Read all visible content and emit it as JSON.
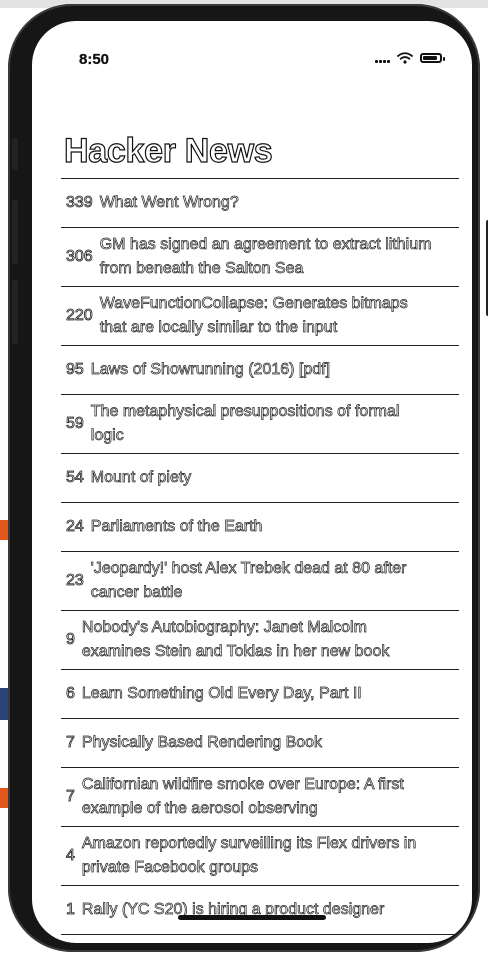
{
  "status_bar": {
    "time": "8:50"
  },
  "app": {
    "title": "Hacker News"
  },
  "stories": [
    {
      "score": "339",
      "title": "What Went Wrong?"
    },
    {
      "score": "306",
      "title": "GM has signed an agreement to extract lithium from beneath the Salton Sea"
    },
    {
      "score": "220",
      "title": "WaveFunctionCollapse: Generates bitmaps that are locally similar to the input"
    },
    {
      "score": "95",
      "title": "Laws of Showrunning (2016) [pdf]"
    },
    {
      "score": "59",
      "title": "The metaphysical presuppositions of formal logic"
    },
    {
      "score": "54",
      "title": "Mount of piety"
    },
    {
      "score": "24",
      "title": "Parliaments of the Earth"
    },
    {
      "score": "23",
      "title": "'Jeopardy!' host Alex Trebek dead at 80 after cancer battle"
    },
    {
      "score": "9",
      "title": "Nobody's Autobiography: Janet Malcolm examines Stein and Toklas in her new book"
    },
    {
      "score": "6",
      "title": "Learn Something Old Every Day, Part II"
    },
    {
      "score": "7",
      "title": "Physically Based Rendering Book"
    },
    {
      "score": "7",
      "title": "Californian wildfire smoke over Europe: A first example of the aerosol observing"
    },
    {
      "score": "4",
      "title": "Amazon reportedly surveilling its Flex drivers in private Facebook groups"
    },
    {
      "score": "1",
      "title": "Rally (YC S20) is hiring a product designer"
    }
  ]
}
